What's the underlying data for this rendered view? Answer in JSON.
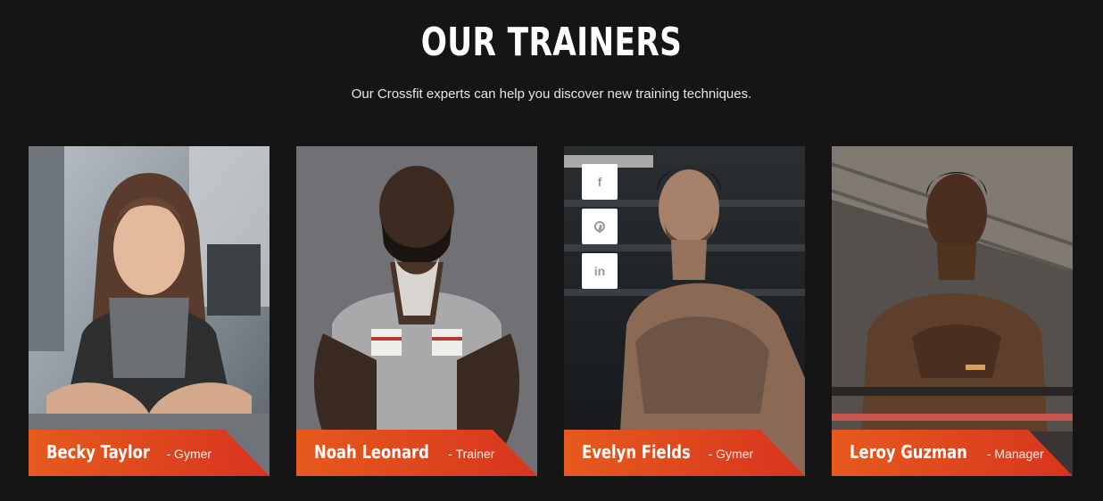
{
  "section": {
    "title": "OUR TRAINERS",
    "subtitle": "Our Crossfit experts can help you discover new training techniques."
  },
  "colors": {
    "background": "#151515",
    "accent_start": "#e65a1e",
    "accent_end": "#d8341f"
  },
  "trainers": [
    {
      "name": "Becky Taylor",
      "role": "- Gymer"
    },
    {
      "name": "Noah Leonard",
      "role": "- Trainer"
    },
    {
      "name": "Evelyn Fields",
      "role": "- Gymer"
    },
    {
      "name": "Leroy Guzman",
      "role": "- Manager"
    }
  ],
  "social_icons": [
    {
      "icon": "facebook-icon",
      "glyph": "f"
    },
    {
      "icon": "pinterest-icon",
      "glyph": "p"
    },
    {
      "icon": "linkedin-icon",
      "glyph": "in"
    }
  ]
}
